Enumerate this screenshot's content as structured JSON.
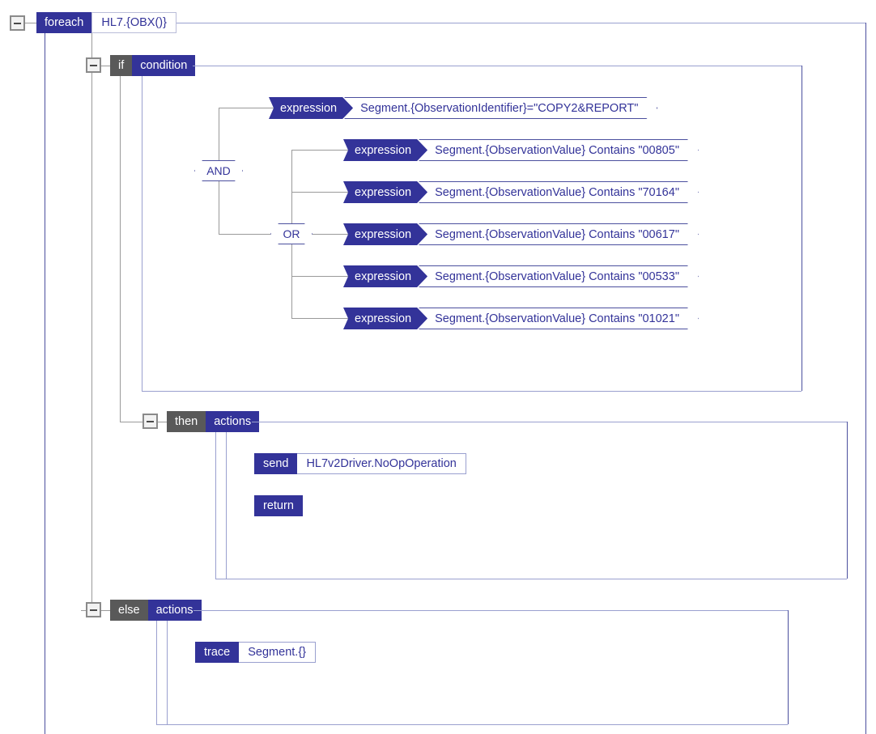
{
  "colors": {
    "accent_blue": "#333399",
    "keyword_gray": "#595959",
    "connector_gray": "#9a9a9a",
    "container_border": "#9aa0cf",
    "text_blue": "#333399",
    "background": "#ffffff"
  },
  "icons": {
    "collapse_minus": "collapse-minus-icon"
  },
  "flow": {
    "foreach": {
      "keyword": "foreach",
      "value": "HL7.{OBX()}"
    },
    "if_block": {
      "keyword": "if",
      "value": "condition",
      "root_operator": "AND",
      "first_expression": {
        "label": "expression",
        "value": "Segment.{ObservationIdentifier}=\"COPY2&REPORT\""
      },
      "nested_operator": "OR",
      "or_expressions": [
        {
          "label": "expression",
          "value": "Segment.{ObservationValue} Contains \"00805\""
        },
        {
          "label": "expression",
          "value": "Segment.{ObservationValue} Contains \"70164\""
        },
        {
          "label": "expression",
          "value": "Segment.{ObservationValue} Contains \"00617\""
        },
        {
          "label": "expression",
          "value": "Segment.{ObservationValue} Contains \"00533\""
        },
        {
          "label": "expression",
          "value": "Segment.{ObservationValue} Contains \"01021\""
        }
      ]
    },
    "then_block": {
      "keyword": "then",
      "value": "actions",
      "actions": [
        {
          "keyword": "send",
          "value": "HL7v2Driver.NoOpOperation"
        },
        {
          "keyword": "return",
          "value": ""
        }
      ]
    },
    "else_block": {
      "keyword": "else",
      "value": "actions",
      "actions": [
        {
          "keyword": "trace",
          "value": "Segment.{}"
        }
      ]
    }
  }
}
